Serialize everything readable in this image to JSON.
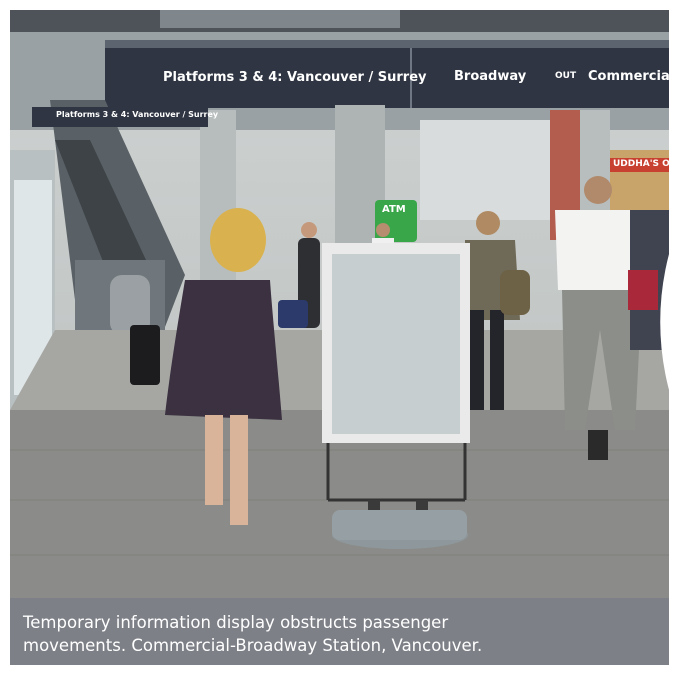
{
  "signs": {
    "main_platforms": "Platforms 3 & 4: Vancouver / Surrey",
    "main_broadway": "Broadway",
    "main_out": "OUT",
    "main_commercial": "Commercial D",
    "small_platforms": "Platforms 3 & 4: Vancouver / Surrey",
    "atm": "ATM",
    "shop": "UDDHA'S Or"
  },
  "caption": {
    "line1": "Temporary information display obstructs passenger",
    "line2": "movements. Commercial-Broadway Station, Vancouver."
  },
  "close_button": {
    "icon": "close-icon",
    "color": "#e8433f"
  },
  "colors": {
    "caption_bg": "#7e8088",
    "sign_bg": "#2f3542"
  }
}
